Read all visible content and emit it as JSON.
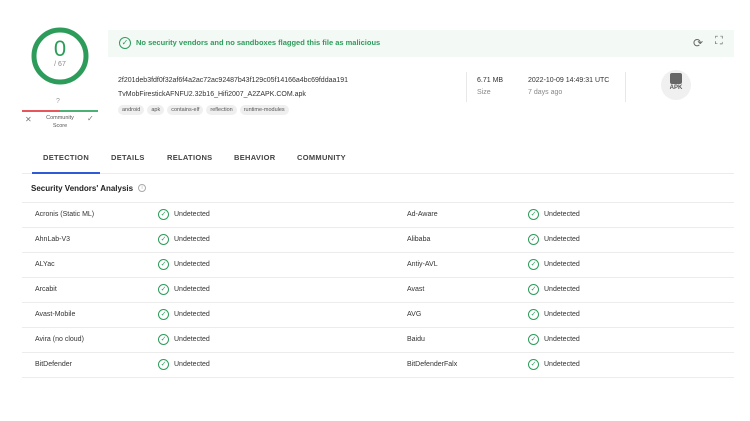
{
  "score": {
    "detections": "0",
    "total": "/ 67",
    "community_question": "?",
    "community_label": "Community Score"
  },
  "banner": {
    "message": "No security vendors and no sandboxes flagged this file as malicious"
  },
  "file": {
    "hash": "2f201deb3fdf0f32af6f4a2ac72ac92487b43f129c05f14166a4bc69fddaa191",
    "name": "TvMobFirestickAFNFU2.32b16_Hifi2007_A2ZAPK.COM.apk",
    "tags": [
      "android",
      "apk",
      "contains-elf",
      "reflection",
      "runtime-modules"
    ],
    "size": "6.71 MB",
    "size_label": "Size",
    "date": "2022-10-09 14:49:31 UTC",
    "date_ago": "7 days ago",
    "type": "APK"
  },
  "tabs": [
    "DETECTION",
    "DETAILS",
    "RELATIONS",
    "BEHAVIOR",
    "COMMUNITY"
  ],
  "section": {
    "title": "Security Vendors' Analysis",
    "info": "i"
  },
  "vendors": [
    {
      "left": "Acronis (Static ML)",
      "left_status": "Undetected",
      "right": "Ad-Aware",
      "right_status": "Undetected"
    },
    {
      "left": "AhnLab-V3",
      "left_status": "Undetected",
      "right": "Alibaba",
      "right_status": "Undetected"
    },
    {
      "left": "ALYac",
      "left_status": "Undetected",
      "right": "Antiy-AVL",
      "right_status": "Undetected"
    },
    {
      "left": "Arcabit",
      "left_status": "Undetected",
      "right": "Avast",
      "right_status": "Undetected"
    },
    {
      "left": "Avast-Mobile",
      "left_status": "Undetected",
      "right": "AVG",
      "right_status": "Undetected"
    },
    {
      "left": "Avira (no cloud)",
      "left_status": "Undetected",
      "right": "Baidu",
      "right_status": "Undetected"
    },
    {
      "left": "BitDefender",
      "left_status": "Undetected",
      "right": "BitDefenderFalx",
      "right_status": "Undetected"
    }
  ],
  "colors": {
    "accent": "#2f5cd6",
    "clean": "#2d9c5b",
    "malicious": "#e6565b"
  }
}
